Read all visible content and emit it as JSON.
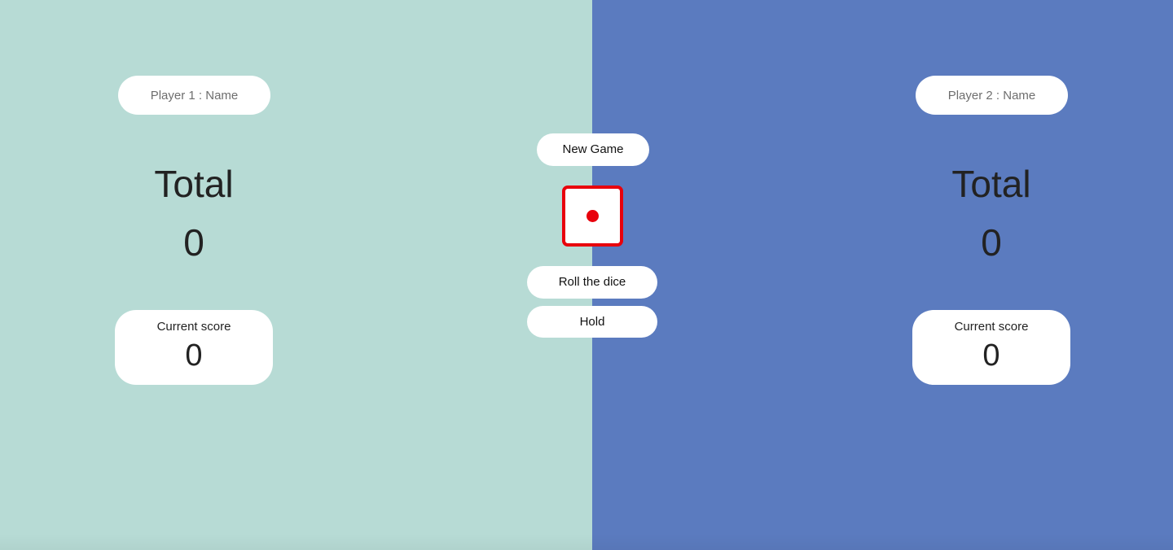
{
  "players": [
    {
      "name_placeholder": "Player 1 : Name",
      "name_value": "",
      "total_label": "Total",
      "total_score": "0",
      "current_label": "Current score",
      "current_score": "0"
    },
    {
      "name_placeholder": "Player 2 : Name",
      "name_value": "",
      "total_label": "Total",
      "total_score": "0",
      "current_label": "Current score",
      "current_score": "0"
    }
  ],
  "controls": {
    "new_game_label": "New Game",
    "roll_label": "Roll the dice",
    "hold_label": "Hold"
  },
  "dice": {
    "face": 1,
    "icon": "dice-one-icon",
    "color": "#e8000c"
  },
  "colors": {
    "player1_background": "#b7dbd5",
    "player2_background": "#5b7bbf",
    "card_background": "#ffffff",
    "text": "#222222"
  }
}
